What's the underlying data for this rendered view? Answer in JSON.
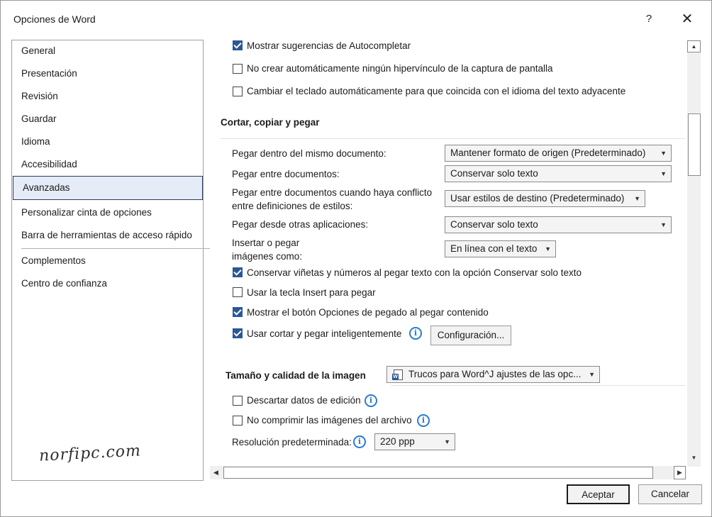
{
  "window": {
    "title": "Opciones de Word",
    "help_glyph": "?",
    "close_glyph": "✕"
  },
  "nav": {
    "items": [
      {
        "label": "General"
      },
      {
        "label": "Presentación"
      },
      {
        "label": "Revisión"
      },
      {
        "label": "Guardar"
      },
      {
        "label": "Idioma"
      },
      {
        "label": "Accesibilidad"
      },
      {
        "label": "Avanzadas",
        "selected": true
      },
      {
        "label": "Personalizar cinta de opciones"
      },
      {
        "label": "Barra de herramientas de acceso rápido"
      },
      {
        "label": "Complementos"
      },
      {
        "label": "Centro de confianza"
      }
    ],
    "watermark": "norfipc.com"
  },
  "top_options": [
    {
      "label": "Mostrar sugerencias de Autocompletar",
      "checked": true
    },
    {
      "label": "No crear automáticamente ningún hipervínculo de la captura de pantalla",
      "checked": false
    },
    {
      "label": "Cambiar el teclado automáticamente para que coincida con el idioma del texto adyacente",
      "checked": false
    }
  ],
  "cut_copy_paste": {
    "title": "Cortar, copiar y pegar",
    "fields": [
      {
        "label": "Pegar dentro del mismo documento:",
        "value": "Mantener formato de origen (Predeterminado)"
      },
      {
        "label": "Pegar entre documentos:",
        "value": "Conservar solo texto"
      },
      {
        "label_line1": "Pegar entre documentos cuando haya conflicto",
        "label_line2": "entre definiciones de estilos:",
        "value": "Usar estilos de destino (Predeterminado)"
      },
      {
        "label": "Pegar desde otras aplicaciones:",
        "value": "Conservar solo texto"
      },
      {
        "label_line1": "Insertar o pegar",
        "label_line2": "imágenes como:",
        "value": "En línea con el texto"
      }
    ],
    "options": [
      {
        "label": "Conservar viñetas y números al pegar texto con la opción Conservar solo texto",
        "checked": true
      },
      {
        "label": "Usar la tecla Insert para pegar",
        "checked": false
      },
      {
        "label": "Mostrar el botón Opciones de pegado al pegar contenido",
        "checked": true
      },
      {
        "label": "Usar cortar y pegar inteligentemente",
        "checked": true
      }
    ],
    "config_button": "Configuración..."
  },
  "image_quality": {
    "title": "Tamaño y calidad de la imagen",
    "document": "Trucos para Word^J ajustes de las opc...",
    "options": [
      {
        "label": "Descartar datos de edición",
        "checked": false
      },
      {
        "label": "No comprimir las imágenes del archivo",
        "checked": false
      }
    ],
    "resolution_label": "Resolución predeterminada:",
    "resolution_value": "220 ppp"
  },
  "footer": {
    "ok": "Aceptar",
    "cancel": "Cancelar"
  },
  "icons": {
    "info": "i",
    "dropdown": "▼",
    "scroll_up": "▲",
    "scroll_down": "▼",
    "scroll_left": "◀",
    "scroll_right": "▶"
  },
  "colors": {
    "accent": "#2b5797",
    "selection": "#e5ecf7",
    "info": "#2b7bd0"
  }
}
